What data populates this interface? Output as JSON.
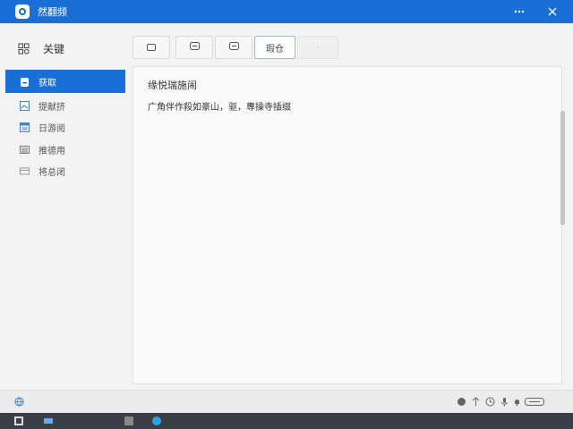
{
  "window": {
    "title": "然翻频"
  },
  "sidebar": {
    "header_label": "关键",
    "items": [
      {
        "label": "获取",
        "icon": "download-icon"
      },
      {
        "label": "提献挤",
        "icon": "image-icon"
      },
      {
        "label": "日游阅",
        "icon": "calendar-icon"
      },
      {
        "label": "推德用",
        "icon": "document-icon"
      },
      {
        "label": "将总闭",
        "icon": "window-icon"
      }
    ]
  },
  "toolbar": {
    "buttons": [
      {
        "label": "",
        "icon": "layout-icon"
      },
      {
        "label": "",
        "icon": "minus-box-icon"
      },
      {
        "label": "",
        "icon": "minus-box-icon"
      },
      {
        "label": "瑕仓"
      },
      {
        "label": "·"
      }
    ]
  },
  "content": {
    "title": "缘悦瑞施闹",
    "body": "广角伴作殺如豪山，驱，專操寺插缀"
  },
  "colors": {
    "accent": "#1a6fd6",
    "taskbar": "#3a3f47"
  }
}
